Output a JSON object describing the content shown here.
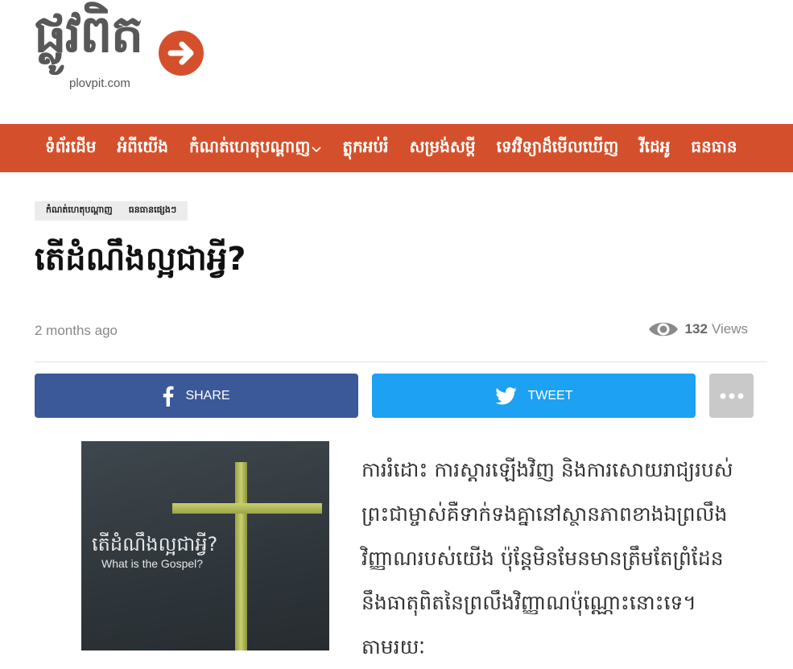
{
  "logo": {
    "wordmark": "ផ្លូវពិត",
    "domain": "plovpit.com"
  },
  "nav": {
    "items": [
      {
        "label": "ទំព័រដើម"
      },
      {
        "label": "អំពីយើង"
      },
      {
        "label": "កំណត់ហេតុបណ្ដាញ",
        "has_dropdown": true
      },
      {
        "label": "ត្លុកអប់រំ"
      },
      {
        "label": "សម្រង់សម្ដី"
      },
      {
        "label": "ទេវវិទ្យាដ៏មើលឃើញ"
      },
      {
        "label": "វីដេអូ"
      },
      {
        "label": "ធនធាន"
      }
    ]
  },
  "article": {
    "categories": [
      "កំណត់ហេតុបណ្ដាញ",
      "ធនធានផ្សេងៗ"
    ],
    "title": "តើដំណឹងល្អជាអ្វី?",
    "date": "2 months ago",
    "views_count": "132",
    "views_label": "Views",
    "share": {
      "facebook_label": "SHARE",
      "twitter_label": "TWEET"
    },
    "image": {
      "title_km": "តើដំណឹងល្អជាអ្វី?",
      "title_en": "What is the Gospel?"
    },
    "body": "ការរំដោះ ការស្ដារឡើងវិញ និងការសោយរាជ្យរបស់ព្រះជាម្ចាស់គឺទាក់ទងគ្នានៅស្ថានភាពខាងឯព្រលឹងវិញ្ញាណរបស់យើង ប៉ុន្តែមិនមែនមានត្រឹមតែព្រំដែននឹងធាតុពិតនៃព្រលឹងវិញ្ញាណប៉ុណ្ណោះនោះទេ។ តាមរយៈ"
  },
  "colors": {
    "brand": "#d4502c",
    "facebook": "#3b5998",
    "twitter": "#1da1f2",
    "more": "#c9c9c9"
  },
  "icons": [
    "arrow-right-icon",
    "chevron-down-icon",
    "eye-icon",
    "facebook-icon",
    "twitter-icon",
    "more-dots-icon"
  ]
}
